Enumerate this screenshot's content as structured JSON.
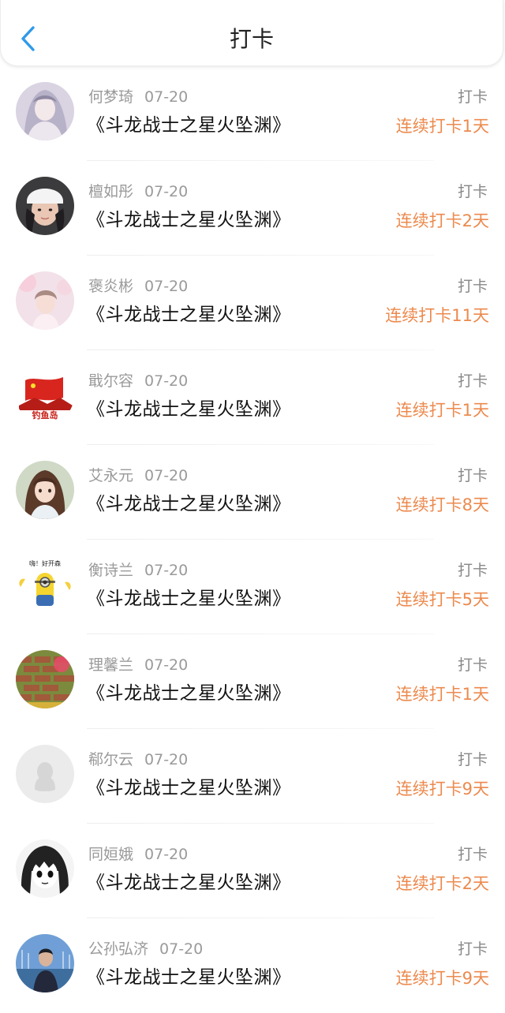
{
  "header": {
    "title": "打卡",
    "back_icon": "chevron-left-icon",
    "accent": "#2f9ae8"
  },
  "colors": {
    "streak": "#ec8a4e",
    "name": "#9a9a9a",
    "title": "#111111"
  },
  "rows": [
    {
      "name": "何梦琦",
      "date": "07-20",
      "book": "《斗龙战士之星火坠渊》",
      "action": "打卡",
      "streak": "连续打卡1天",
      "avatar": "anime-girl-avatar"
    },
    {
      "name": "檀如彤",
      "date": "07-20",
      "book": "《斗龙战士之星火坠渊》",
      "action": "打卡",
      "streak": "连续打卡2天",
      "avatar": "girl-white-cap-avatar"
    },
    {
      "name": "褒炎彬",
      "date": "07-20",
      "book": "《斗龙战士之星火坠渊》",
      "action": "打卡",
      "streak": "连续打卡11天",
      "avatar": "pink-blossom-girl-avatar"
    },
    {
      "name": "戢尔容",
      "date": "07-20",
      "book": "《斗龙战士之星火坠渊》",
      "action": "打卡",
      "streak": "连续打卡1天",
      "avatar": "flag-diaoyudao-avatar",
      "avatar_text": "钓鱼岛"
    },
    {
      "name": "艾永元",
      "date": "07-20",
      "book": "《斗龙战士之星火坠渊》",
      "action": "打卡",
      "streak": "连续打卡8天",
      "avatar": "illustrated-girl-avatar"
    },
    {
      "name": "衡诗兰",
      "date": "07-20",
      "book": "《斗龙战士之星火坠渊》",
      "action": "打卡",
      "streak": "连续打卡5天",
      "avatar": "minion-avatar",
      "avatar_text": "嗨！好开森"
    },
    {
      "name": "理馨兰",
      "date": "07-20",
      "book": "《斗龙战士之星火坠渊》",
      "action": "打卡",
      "streak": "连续打卡1天",
      "avatar": "brick-wall-avatar"
    },
    {
      "name": "郗尔云",
      "date": "07-20",
      "book": "《斗龙战士之星火坠渊》",
      "action": "打卡",
      "streak": "连续打卡9天",
      "avatar": "default-penguin-avatar"
    },
    {
      "name": "同姮娥",
      "date": "07-20",
      "book": "《斗龙战士之星火坠渊》",
      "action": "打卡",
      "streak": "连续打卡2天",
      "avatar": "manga-girl-avatar"
    },
    {
      "name": "公孙弘济",
      "date": "07-20",
      "book": "《斗龙战士之星火坠渊》",
      "action": "打卡",
      "streak": "连续打卡9天",
      "avatar": "harbor-man-avatar"
    }
  ]
}
